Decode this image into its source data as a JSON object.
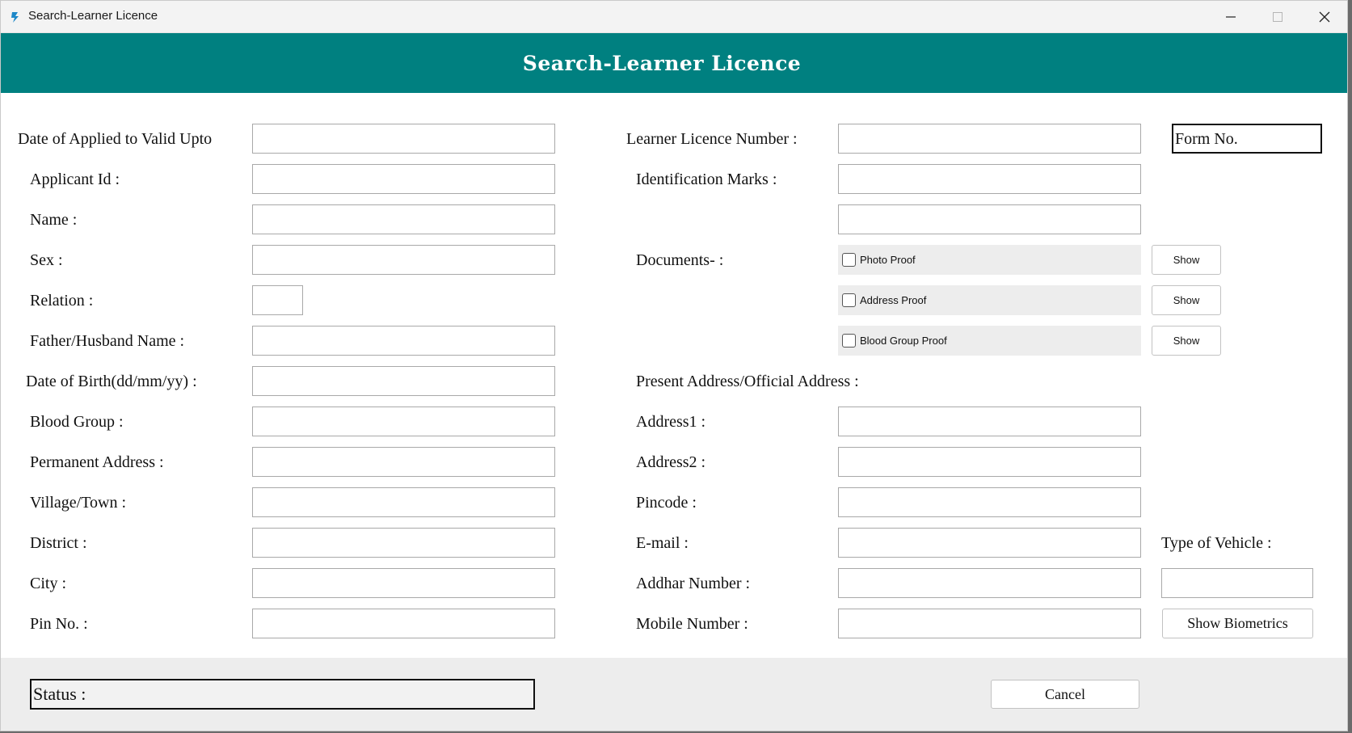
{
  "window": {
    "title": "Search-Learner Licence"
  },
  "banner": {
    "title": "Search-Learner Licence"
  },
  "left_fields": [
    {
      "label": "Date of Applied to Valid Upto",
      "value": ""
    },
    {
      "label": "Applicant Id :",
      "value": ""
    },
    {
      "label": "Name :",
      "value": ""
    },
    {
      "label": "Sex :",
      "value": ""
    },
    {
      "label": "Relation :",
      "value": ""
    },
    {
      "label": "Father/Husband Name :",
      "value": ""
    },
    {
      "label": "Date of Birth(dd/mm/yy) :",
      "value": ""
    },
    {
      "label": "Blood Group :",
      "value": ""
    },
    {
      "label": "Permanent Address :",
      "value": ""
    },
    {
      "label": "Village/Town :",
      "value": ""
    },
    {
      "label": "District :",
      "value": ""
    },
    {
      "label": "City :",
      "value": ""
    },
    {
      "label": "Pin No. :",
      "value": ""
    }
  ],
  "right": {
    "learner_licence_number_label": "Learner Licence Number :",
    "identification_marks_label": "Identification Marks :",
    "documents_label": "Documents- :",
    "documents": [
      {
        "label": "Photo Proof",
        "checked": false,
        "button": "Show"
      },
      {
        "label": "Address Proof",
        "checked": false,
        "button": "Show"
      },
      {
        "label": "Blood Group Proof",
        "checked": false,
        "button": "Show"
      }
    ],
    "present_address_label": "Present Address/Official Address :",
    "address1_label": "Address1 :",
    "address2_label": "Address2 :",
    "pincode_label": "Pincode :",
    "email_label": "E-mail :",
    "addhar_label": "Addhar Number :",
    "mobile_label": "Mobile Number :",
    "form_no": "Form No.",
    "type_of_vehicle_label": "Type of Vehicle :",
    "show_biometrics": "Show Biometrics"
  },
  "footer": {
    "status": "Status :",
    "cancel": "Cancel"
  }
}
